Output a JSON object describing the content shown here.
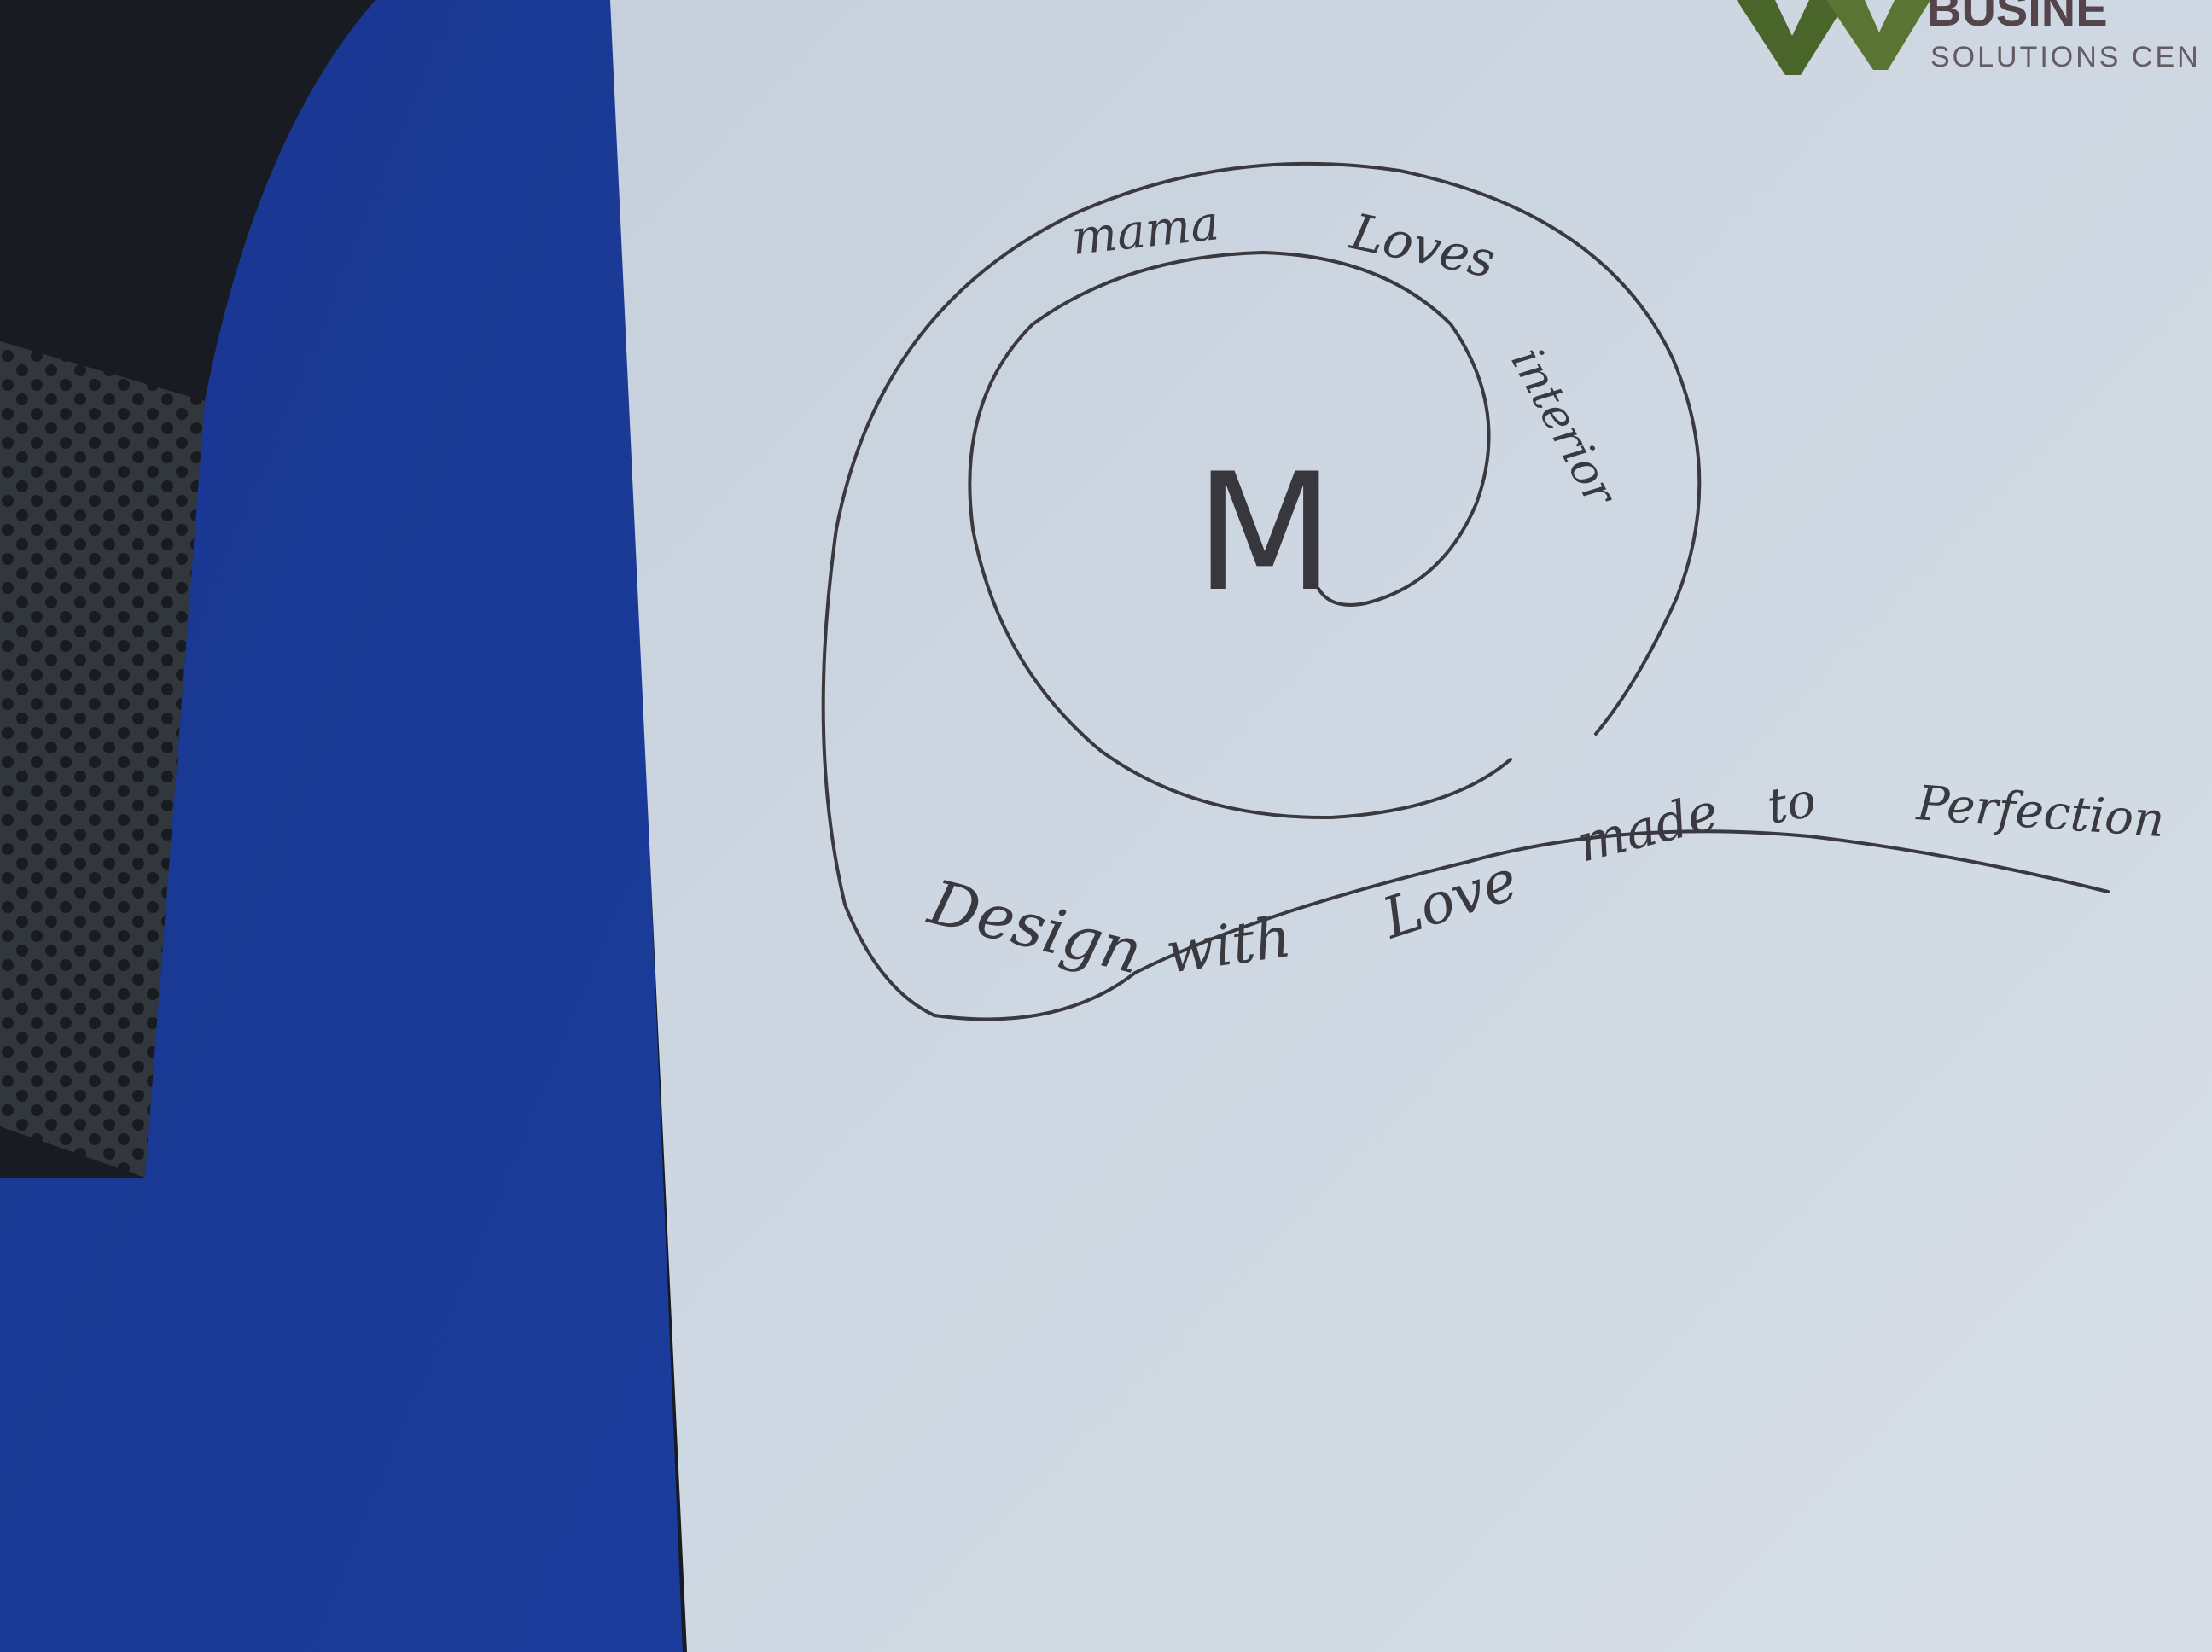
{
  "letterhead": {
    "brand_word": "BUSINE",
    "tagline": "SOLUTIONS CEN"
  },
  "sketch": {
    "center_letter": "M",
    "arc_words": [
      "mama",
      "Loves",
      "interior"
    ],
    "slogan_words": [
      "Design",
      "with",
      "Love",
      "made",
      "to",
      "Perfection"
    ]
  },
  "colors": {
    "paper": "#d6e0ec",
    "folder_blue": "#1f3f9c",
    "ink": "#3c3c42",
    "logo_green": "#4e6a2c"
  }
}
